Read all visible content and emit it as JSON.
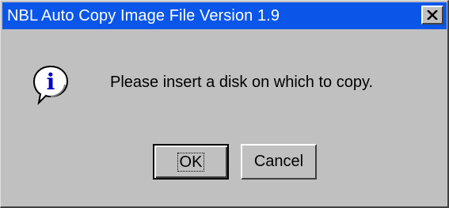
{
  "window": {
    "title": "NBL Auto Copy Image File Version 1.9",
    "close_icon": "close-icon",
    "title_bar_color": "#0a56e8"
  },
  "dialog": {
    "icon": "info-icon",
    "icon_glyph": "i",
    "message": "Please insert a disk on which to copy."
  },
  "buttons": {
    "ok_label": "OK",
    "cancel_label": "Cancel"
  }
}
